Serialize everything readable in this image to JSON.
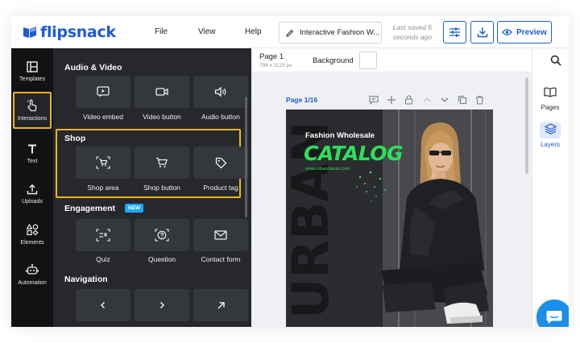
{
  "header": {
    "brand": "flipsnack",
    "menu": {
      "file": "File",
      "view": "View",
      "help": "Help"
    },
    "doc_title": "Interactive Fashion W...",
    "saved_line1": "Last saved 5",
    "saved_line2": "seconds ago",
    "preview_label": "Preview"
  },
  "rail": {
    "templates": "Templates",
    "interactions": "Interactions",
    "text": "Text",
    "uploads": "Uploads",
    "elements": "Elements",
    "automation": "Automation"
  },
  "panel": {
    "audio_video": {
      "title": "Audio & Video",
      "items": [
        "Video embed",
        "Video button",
        "Audio button"
      ]
    },
    "shop": {
      "title": "Shop",
      "items": [
        "Shop area",
        "Shop button",
        "Product tag"
      ]
    },
    "engagement": {
      "title": "Engagement",
      "badge": "NEW",
      "items": [
        "Quiz",
        "Question",
        "Contact form"
      ]
    },
    "navigation": {
      "title": "Navigation"
    }
  },
  "canvas": {
    "page_name": "Page 1",
    "page_size": "794 x 1123 px",
    "background_label": "Background",
    "page_indicator": "Page 1/16",
    "page_content": {
      "subtitle": "Fashion Wholesale",
      "title": "CATALOG",
      "url": "www.urbanclassic.com"
    }
  },
  "right_panel": {
    "pages": "Pages",
    "layers": "Layers"
  },
  "colors": {
    "accent": "#1f5bd6",
    "highlight": "#f2b41c",
    "catalog_green": "#2de05a",
    "panel_bg": "#26282c",
    "rail_bg": "#111214"
  }
}
